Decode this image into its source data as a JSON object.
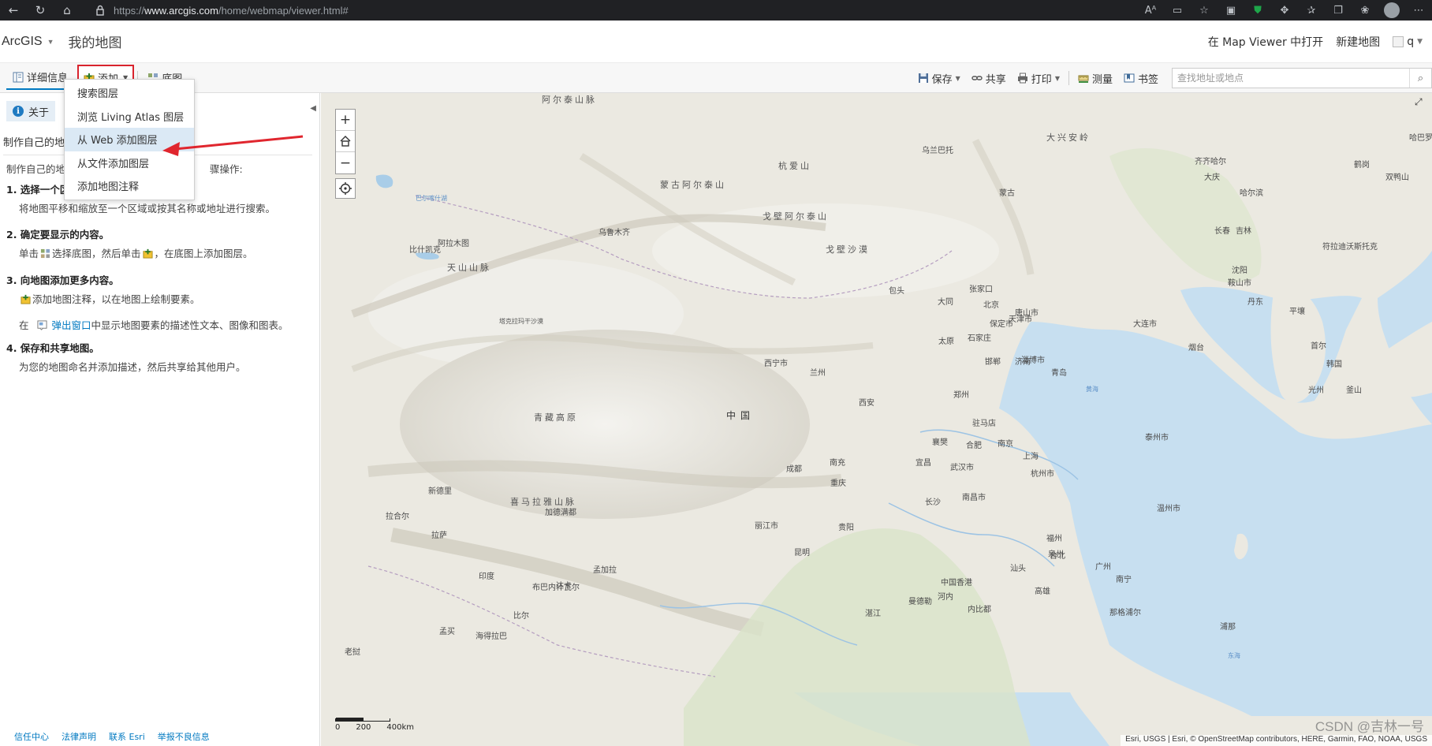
{
  "browser": {
    "url_prefix": "https://",
    "url_domain": "www.arcgis.com",
    "url_path": "/home/webmap/viewer.html#"
  },
  "header": {
    "brand": "ArcGIS",
    "map_title": "我的地图",
    "open_in_viewer": "在 Map Viewer 中打开",
    "new_map": "新建地图",
    "user": "q"
  },
  "toolbar": {
    "details": "详细信息",
    "add": "添加",
    "basemap": "底图",
    "save": "保存",
    "share": "共享",
    "print": "打印",
    "measure": "测量",
    "bookmarks": "书签",
    "search_placeholder": "查找地址或地点"
  },
  "add_menu": {
    "items": [
      {
        "label": "搜索图层"
      },
      {
        "label": "浏览 Living Atlas 图层"
      },
      {
        "label": "从 Web 添加图层"
      },
      {
        "label": "从文件添加图层"
      },
      {
        "label": "添加地图注释"
      }
    ],
    "active_index": 2
  },
  "left_panel": {
    "tab_about": "关于",
    "heading": "制作自己的地图",
    "intro_start": "制作自己的地图",
    "intro_tail": "骤操作:",
    "steps": [
      {
        "title": "1. 选择一个区域",
        "text": "将地图平移和缩放至一个区域或按其名称或地址进行搜索。"
      },
      {
        "title": "2. 确定要显示的内容。",
        "text_a": "单击",
        "text_b": "选择底图，然后单击",
        "text_c": "，在底图上添加图层。"
      },
      {
        "title": "3. 向地图添加更多内容。",
        "text_a": "添加地图注释，以在地图上绘制要素。",
        "text_b_pre": "在",
        "text_b_link": "弹出窗口",
        "text_b_post": "中显示地图要素的描述性文本、图像和图表。"
      },
      {
        "title": "4. 保存和共享地图。",
        "text": "为您的地图命名并添加描述，然后共享给其他用户。"
      }
    ],
    "footer": [
      "信任中心",
      "法律声明",
      "联系 Esri",
      "举报不良信息"
    ]
  },
  "map": {
    "labels": [
      {
        "text": "阿尔泰山脉",
        "cls": "big"
      },
      {
        "text": "乌兰巴托",
        "cls": ""
      },
      {
        "text": "大兴安岭",
        "cls": "big"
      },
      {
        "text": "哈巴罗夫斯克",
        "cls": ""
      },
      {
        "text": "蒙古",
        "cls": ""
      },
      {
        "text": "蒙古阿尔泰山",
        "cls": "big"
      },
      {
        "text": "杭爱山",
        "cls": "big"
      },
      {
        "text": "齐齐哈尔",
        "cls": ""
      },
      {
        "text": "鹤岗",
        "cls": ""
      },
      {
        "text": "大庆",
        "cls": ""
      },
      {
        "text": "双鸭山",
        "cls": ""
      },
      {
        "text": "哈尔滨",
        "cls": ""
      },
      {
        "text": "戈壁阿尔泰山",
        "cls": "big"
      },
      {
        "text": "乌鲁木齐",
        "cls": ""
      },
      {
        "text": "长春",
        "cls": ""
      },
      {
        "text": "吉林",
        "cls": ""
      },
      {
        "text": "阿拉木图",
        "cls": ""
      },
      {
        "text": "比什凯克",
        "cls": ""
      },
      {
        "text": "天山山脉",
        "cls": "big"
      },
      {
        "text": "戈壁沙漠",
        "cls": "big"
      },
      {
        "text": "符拉迪沃斯托克",
        "cls": ""
      },
      {
        "text": "沈阳",
        "cls": ""
      },
      {
        "text": "鞍山市",
        "cls": ""
      },
      {
        "text": "包头",
        "cls": ""
      },
      {
        "text": "张家口",
        "cls": ""
      },
      {
        "text": "大同",
        "cls": ""
      },
      {
        "text": "北京",
        "cls": ""
      },
      {
        "text": "唐山市",
        "cls": ""
      },
      {
        "text": "丹东",
        "cls": ""
      },
      {
        "text": "保定市",
        "cls": ""
      },
      {
        "text": "天津市",
        "cls": ""
      },
      {
        "text": "大连市",
        "cls": ""
      },
      {
        "text": "平壤",
        "cls": ""
      },
      {
        "text": "塔克拉玛干沙漠",
        "cls": "tiny"
      },
      {
        "text": "太原",
        "cls": ""
      },
      {
        "text": "石家庄",
        "cls": ""
      },
      {
        "text": "烟台",
        "cls": ""
      },
      {
        "text": "首尔",
        "cls": ""
      },
      {
        "text": "西宁市",
        "cls": ""
      },
      {
        "text": "兰州",
        "cls": ""
      },
      {
        "text": "邯郸",
        "cls": ""
      },
      {
        "text": "济南",
        "cls": ""
      },
      {
        "text": "淄博市",
        "cls": ""
      },
      {
        "text": "青岛",
        "cls": ""
      },
      {
        "text": "韩国",
        "cls": ""
      },
      {
        "text": "郑州",
        "cls": ""
      },
      {
        "text": "光州",
        "cls": ""
      },
      {
        "text": "釜山",
        "cls": ""
      },
      {
        "text": "西安",
        "cls": ""
      },
      {
        "text": "青藏高原",
        "cls": "big"
      },
      {
        "text": "中国",
        "cls": "country"
      },
      {
        "text": "驻马店",
        "cls": ""
      },
      {
        "text": "泰州市",
        "cls": ""
      },
      {
        "text": "襄樊",
        "cls": ""
      },
      {
        "text": "合肥",
        "cls": ""
      },
      {
        "text": "南京",
        "cls": ""
      },
      {
        "text": "上海",
        "cls": ""
      },
      {
        "text": "成都",
        "cls": ""
      },
      {
        "text": "南充",
        "cls": ""
      },
      {
        "text": "宜昌",
        "cls": ""
      },
      {
        "text": "武汉市",
        "cls": ""
      },
      {
        "text": "杭州市",
        "cls": ""
      },
      {
        "text": "重庆",
        "cls": ""
      },
      {
        "text": "新德里",
        "cls": ""
      },
      {
        "text": "喜马拉雅山脉",
        "cls": "big"
      },
      {
        "text": "长沙",
        "cls": ""
      },
      {
        "text": "南昌市",
        "cls": ""
      },
      {
        "text": "温州市",
        "cls": ""
      },
      {
        "text": "拉合尔",
        "cls": ""
      },
      {
        "text": "加德满都",
        "cls": ""
      },
      {
        "text": "拉萨",
        "cls": ""
      },
      {
        "text": "丽江市",
        "cls": ""
      },
      {
        "text": "贵阳",
        "cls": ""
      },
      {
        "text": "福州",
        "cls": ""
      },
      {
        "text": "泉州",
        "cls": ""
      },
      {
        "text": "台北",
        "cls": ""
      },
      {
        "text": "昆明",
        "cls": ""
      },
      {
        "text": "广州",
        "cls": ""
      },
      {
        "text": "汕头",
        "cls": ""
      },
      {
        "text": "南宁",
        "cls": ""
      },
      {
        "text": "中国香港",
        "cls": ""
      },
      {
        "text": "高雄",
        "cls": ""
      },
      {
        "text": "达卡",
        "cls": ""
      },
      {
        "text": "印度",
        "cls": ""
      },
      {
        "text": "孟加拉",
        "cls": ""
      },
      {
        "text": "曼德勒",
        "cls": ""
      },
      {
        "text": "河内",
        "cls": ""
      },
      {
        "text": "湛江",
        "cls": ""
      },
      {
        "text": "那格浦尔",
        "cls": ""
      },
      {
        "text": "比尔",
        "cls": ""
      },
      {
        "text": "布巴内什瓦尔",
        "cls": ""
      },
      {
        "text": "海得拉巴",
        "cls": ""
      },
      {
        "text": "孟买",
        "cls": ""
      },
      {
        "text": "浦那",
        "cls": ""
      },
      {
        "text": "老挝",
        "cls": ""
      },
      {
        "text": "内比都",
        "cls": ""
      },
      {
        "text": "巴尔喀什湖",
        "cls": "water"
      },
      {
        "text": "黄海",
        "cls": "water"
      },
      {
        "text": "东海",
        "cls": "water"
      }
    ],
    "scale_labels": [
      "0",
      "200",
      "400km"
    ],
    "attribution": "Esri, USGS | Esri, © OpenStreetMap contributors, HERE, Garmin, FAO, NOAA, USGS",
    "watermark": "CSDN @吉林一号"
  }
}
